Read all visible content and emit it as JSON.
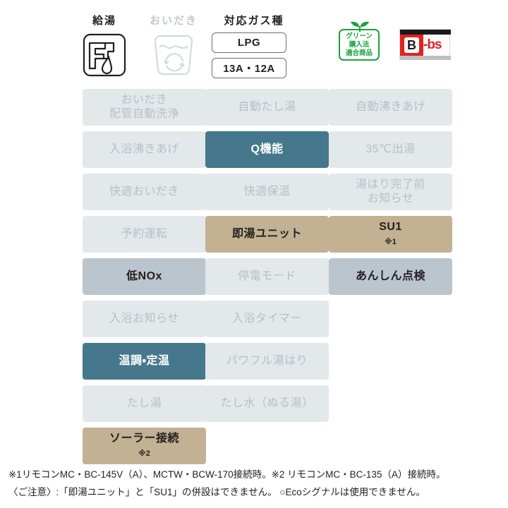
{
  "header": {
    "hot_water": {
      "label": "給湯",
      "icon": "faucet-water-icon",
      "state": "on"
    },
    "reheat": {
      "label": "おいだき",
      "icon": "bathtub-reheat-icon",
      "state": "off"
    },
    "gas": {
      "label": "対応ガス種",
      "options": [
        "LPG",
        "13A・12A"
      ]
    },
    "green_badge": {
      "name": "green-purchasing-law-badge",
      "lines": [
        "グリーン",
        "購入法",
        "適合商品"
      ],
      "color": "#19a33c"
    },
    "bbs_badge": {
      "name": "b-bs-badge",
      "mark": "B",
      "text": "-bs",
      "color": "#e0231f"
    }
  },
  "features": {
    "legend": {
      "off": "#e3e8ea",
      "teal": "#45788c",
      "tan": "#c2b193",
      "blue": "#bbc5cd"
    },
    "rows": [
      [
        {
          "label": "おいだき\n配管自動洗浄",
          "line1": "おいだき",
          "line2": "配管自動洗浄",
          "state": "off"
        },
        {
          "label": "自動たし湯",
          "line1": "自動たし湯",
          "line2": "",
          "state": "off"
        },
        {
          "label": "自動沸きあげ",
          "line1": "自動沸きあげ",
          "line2": "",
          "state": "off"
        }
      ],
      [
        {
          "label": "入浴沸きあげ",
          "line1": "入浴沸きあげ",
          "line2": "",
          "state": "off"
        },
        {
          "label": "Q機能",
          "line1": "Q機能",
          "line2": "",
          "state": "teal"
        },
        {
          "label": "35℃出湯",
          "line1": "35℃出湯",
          "line2": "",
          "state": "off"
        }
      ],
      [
        {
          "label": "快適おいだき",
          "line1": "快適おいだき",
          "line2": "",
          "state": "off"
        },
        {
          "label": "快適保温",
          "line1": "快適保温",
          "line2": "",
          "state": "off"
        },
        {
          "label": "湯はり完了前\nお知らせ",
          "line1": "湯はり完了前",
          "line2": "お知らせ",
          "state": "off"
        }
      ],
      [
        {
          "label": "予約運転",
          "line1": "予約運転",
          "line2": "",
          "state": "off"
        },
        {
          "label": "即湯ユニット",
          "line1": "即湯ユニット",
          "line2": "",
          "state": "tan"
        },
        {
          "label": "SU1",
          "line1": "SU1",
          "line2": "",
          "note": "※1",
          "state": "tan"
        }
      ],
      [
        {
          "label": "低NOx",
          "line1": "低NOx",
          "line2": "",
          "state": "blue"
        },
        {
          "label": "停電モード",
          "line1": "停電モード",
          "line2": "",
          "state": "off"
        },
        {
          "label": "あんしん点検",
          "line1": "あんしん点検",
          "line2": "",
          "state": "blue"
        }
      ],
      [
        {
          "label": "入浴お知らせ",
          "line1": "入浴お知らせ",
          "line2": "",
          "state": "off"
        },
        {
          "label": "入浴タイマー",
          "line1": "入浴タイマー",
          "line2": "",
          "state": "off"
        },
        {
          "label": "",
          "line1": "",
          "line2": "",
          "state": "empty"
        }
      ],
      [
        {
          "label": "温調・定温",
          "line1": "温調・定温",
          "line2": "",
          "state": "teal"
        },
        {
          "label": "パワフル湯はり",
          "line1": "パワフル湯はり",
          "line2": "",
          "state": "off"
        },
        {
          "label": "",
          "line1": "",
          "line2": "",
          "state": "empty"
        }
      ],
      [
        {
          "label": "たし湯",
          "line1": "たし湯",
          "line2": "",
          "state": "off"
        },
        {
          "label": "たし水（ぬる湯）",
          "line1": "たし水（ぬる湯）",
          "line2": "",
          "state": "off"
        },
        {
          "label": "",
          "line1": "",
          "line2": "",
          "state": "empty"
        }
      ],
      [
        {
          "label": "ソーラー接続",
          "line1": "ソーラー接続",
          "line2": "",
          "note": "※2",
          "state": "tan"
        },
        {
          "label": "",
          "line1": "",
          "line2": "",
          "state": "empty"
        },
        {
          "label": "",
          "line1": "",
          "line2": "",
          "state": "empty"
        }
      ]
    ]
  },
  "notes": {
    "line1": "※1リモコンMC・BC-145V（A）、MCTW・BCW-170接続時。※2 リモコンMC・BC-135（A）接続時。",
    "line2": "〈ご注意〉:「即湯ユニット」と「SU1」の併設はできません。 ○Ecoシグナルは使用できません。"
  }
}
